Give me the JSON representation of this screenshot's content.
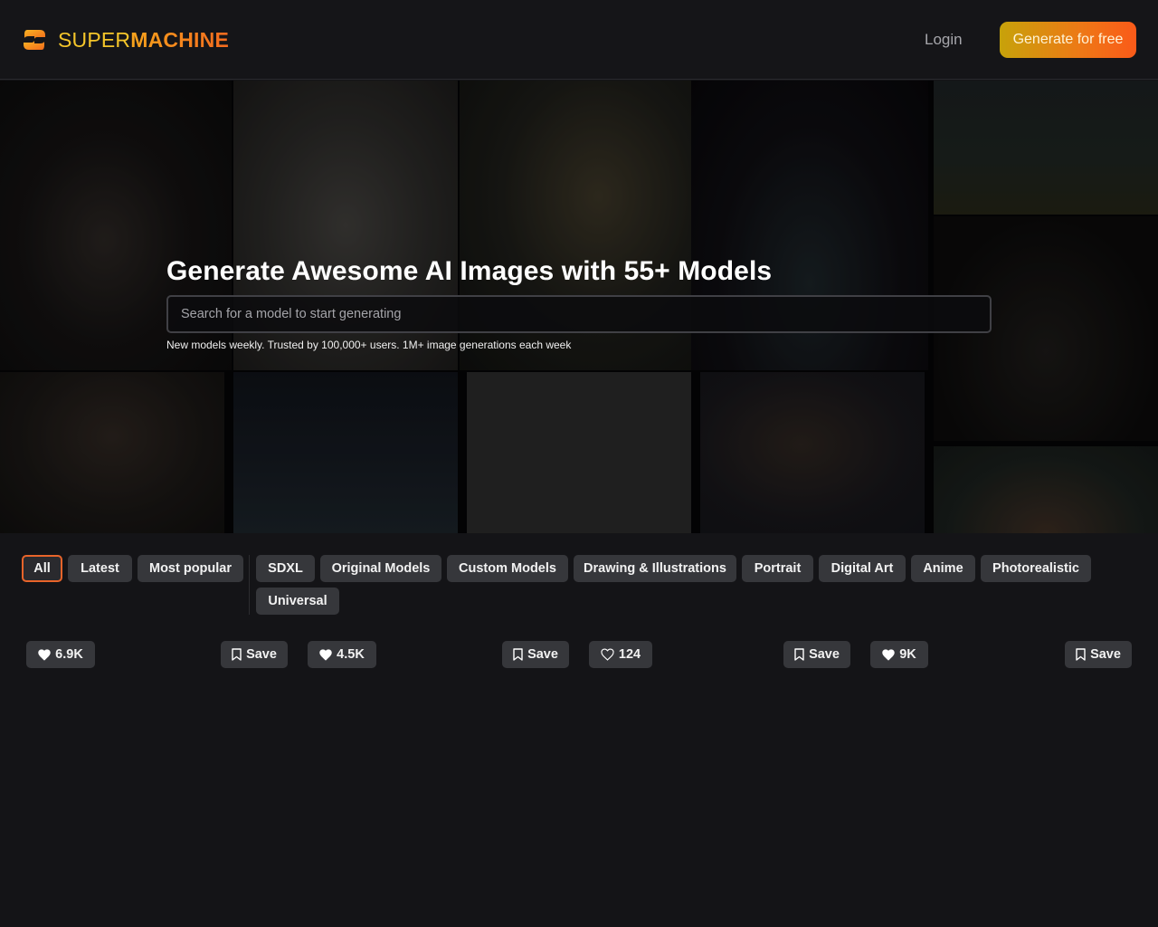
{
  "header": {
    "brand_part1": "SUPER",
    "brand_part2": "MACHINE",
    "login_label": "Login",
    "cta_label": "Generate for free",
    "brand_colors": {
      "yellow": "#f4c52a",
      "orange": "#f46a1e"
    }
  },
  "hero": {
    "title": "Generate Awesome AI Images with 55+ Models",
    "search_placeholder": "Search for a model to start generating",
    "search_value": "",
    "subtitle": "New models weekly. Trusted by 100,000+ users. 1M+ image generations each week"
  },
  "filters": {
    "primary": [
      {
        "label": "All",
        "active": true
      },
      {
        "label": "Latest",
        "active": false
      },
      {
        "label": "Most popular",
        "active": false
      }
    ],
    "categories": [
      {
        "label": "SDXL"
      },
      {
        "label": "Original Models"
      },
      {
        "label": "Custom Models"
      },
      {
        "label": "Drawing & Illustrations"
      },
      {
        "label": "Portrait"
      },
      {
        "label": "Digital Art"
      },
      {
        "label": "Anime"
      },
      {
        "label": "Photorealistic"
      },
      {
        "label": "Universal"
      }
    ]
  },
  "cards": [
    {
      "likes": "6.9K",
      "liked_icon": "heart-filled",
      "save_label": "Save"
    },
    {
      "likes": "4.5K",
      "liked_icon": "heart-filled",
      "save_label": "Save"
    },
    {
      "likes": "124",
      "liked_icon": "heart-outline",
      "save_label": "Save"
    },
    {
      "likes": "9K",
      "liked_icon": "heart-filled",
      "save_label": "Save"
    }
  ],
  "colors": {
    "background": "#141417",
    "chip": "#36373b",
    "active_border": "#e8642a"
  }
}
